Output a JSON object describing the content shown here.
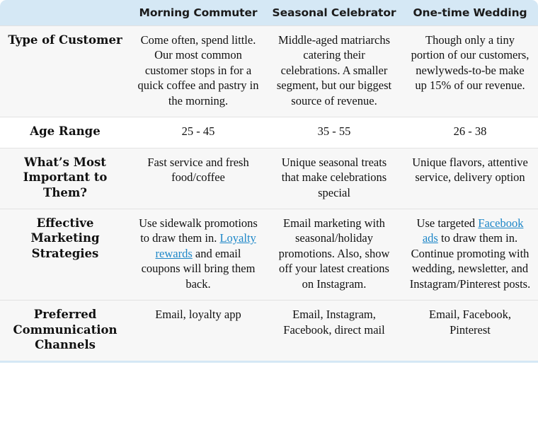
{
  "table": {
    "columns": [
      {
        "key": "label",
        "label": ""
      },
      {
        "key": "morning",
        "label": "Morning Commuter"
      },
      {
        "key": "seasonal",
        "label": "Seasonal Celebrator"
      },
      {
        "key": "wedding",
        "label": "One-time Wedding"
      }
    ],
    "header_bg": "#d5e8f5",
    "link_color": "#1e87c8",
    "rows": [
      {
        "label": "Type of Customer",
        "shaded": true,
        "morning": "Come often, spend little. Our most common customer stops in for a quick coffee and pastry in the morning.",
        "seasonal": "Middle-aged matriarchs catering their celebrations. A smaller segment, but our biggest source of revenue.",
        "wedding": "Though only a tiny portion of our customers, newlyweds-to-be make up 15% of our revenue."
      },
      {
        "label": "Age Range",
        "shaded": false,
        "morning": "25 - 45",
        "seasonal": "35 - 55",
        "wedding": "26 - 38"
      },
      {
        "label": "What’s Most Important to Them?",
        "shaded": true,
        "morning": "Fast service and fresh food/coffee",
        "seasonal": "Unique seasonal treats that make celebrations special",
        "wedding": "Unique flavors, attentive service, delivery option"
      },
      {
        "label": "Effective Marketing Strategies",
        "shaded": true,
        "morning_parts": [
          {
            "text": "Use sidewalk promotions to draw them in. ",
            "link": false
          },
          {
            "text": "Loyalty rewards",
            "link": true
          },
          {
            "text": " and email coupons will bring them back.",
            "link": false
          }
        ],
        "seasonal": "Email marketing with seasonal/holiday promotions. Also, show off your latest creations on Instagram.",
        "wedding_parts": [
          {
            "text": "Use targeted ",
            "link": false
          },
          {
            "text": "Facebook ads",
            "link": true
          },
          {
            "text": " to draw them in. Continue promoting with wedding, newsletter, and Instagram/Pinterest posts.",
            "link": false
          }
        ]
      },
      {
        "label": "Preferred Communication Channels",
        "shaded": true,
        "morning": "Email, loyalty app",
        "seasonal": "Email, Instagram, Facebook, direct mail",
        "wedding": "Email, Facebook, Pinterest"
      }
    ]
  }
}
